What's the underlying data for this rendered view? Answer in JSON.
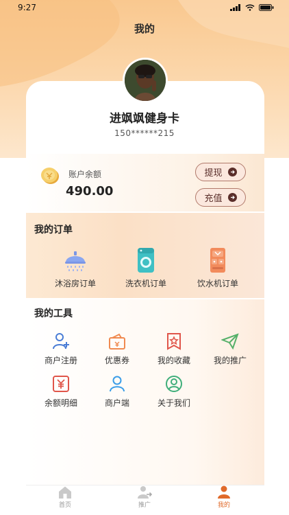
{
  "status_bar": {
    "time": "9:27"
  },
  "header": {
    "title": "我的"
  },
  "profile": {
    "name": "进飒飒健身卡",
    "phone": "150******215"
  },
  "balance": {
    "label": "账户余额",
    "value": "490.00",
    "withdraw_label": "提现",
    "recharge_label": "充值"
  },
  "orders": {
    "title": "我的订单",
    "items": [
      {
        "label": "沐浴房订单",
        "icon": "shower-icon"
      },
      {
        "label": "洗衣机订单",
        "icon": "washing-machine-icon"
      },
      {
        "label": "饮水机订单",
        "icon": "water-dispenser-icon"
      }
    ]
  },
  "tools": {
    "title": "我的工具",
    "items": [
      {
        "label": "商户注册",
        "icon": "add-user-icon"
      },
      {
        "label": "优惠券",
        "icon": "wallet-icon"
      },
      {
        "label": "我的收藏",
        "icon": "star-bookmark-icon"
      },
      {
        "label": "我的推广",
        "icon": "paper-plane-icon"
      },
      {
        "label": "余额明细",
        "icon": "yen-icon"
      },
      {
        "label": "商户端",
        "icon": "user-icon"
      },
      {
        "label": "关于我们",
        "icon": "user-circle-icon"
      }
    ]
  },
  "tabbar": {
    "items": [
      {
        "label": "首页",
        "icon": "home-icon"
      },
      {
        "label": "推广",
        "icon": "share-user-icon"
      },
      {
        "label": "我的",
        "icon": "person-icon"
      }
    ]
  },
  "colors": {
    "accent": "#e06a2a",
    "header_gradient_start": "#f9c88f",
    "button_border": "#b17a6b",
    "button_text": "#5a2e2a"
  }
}
